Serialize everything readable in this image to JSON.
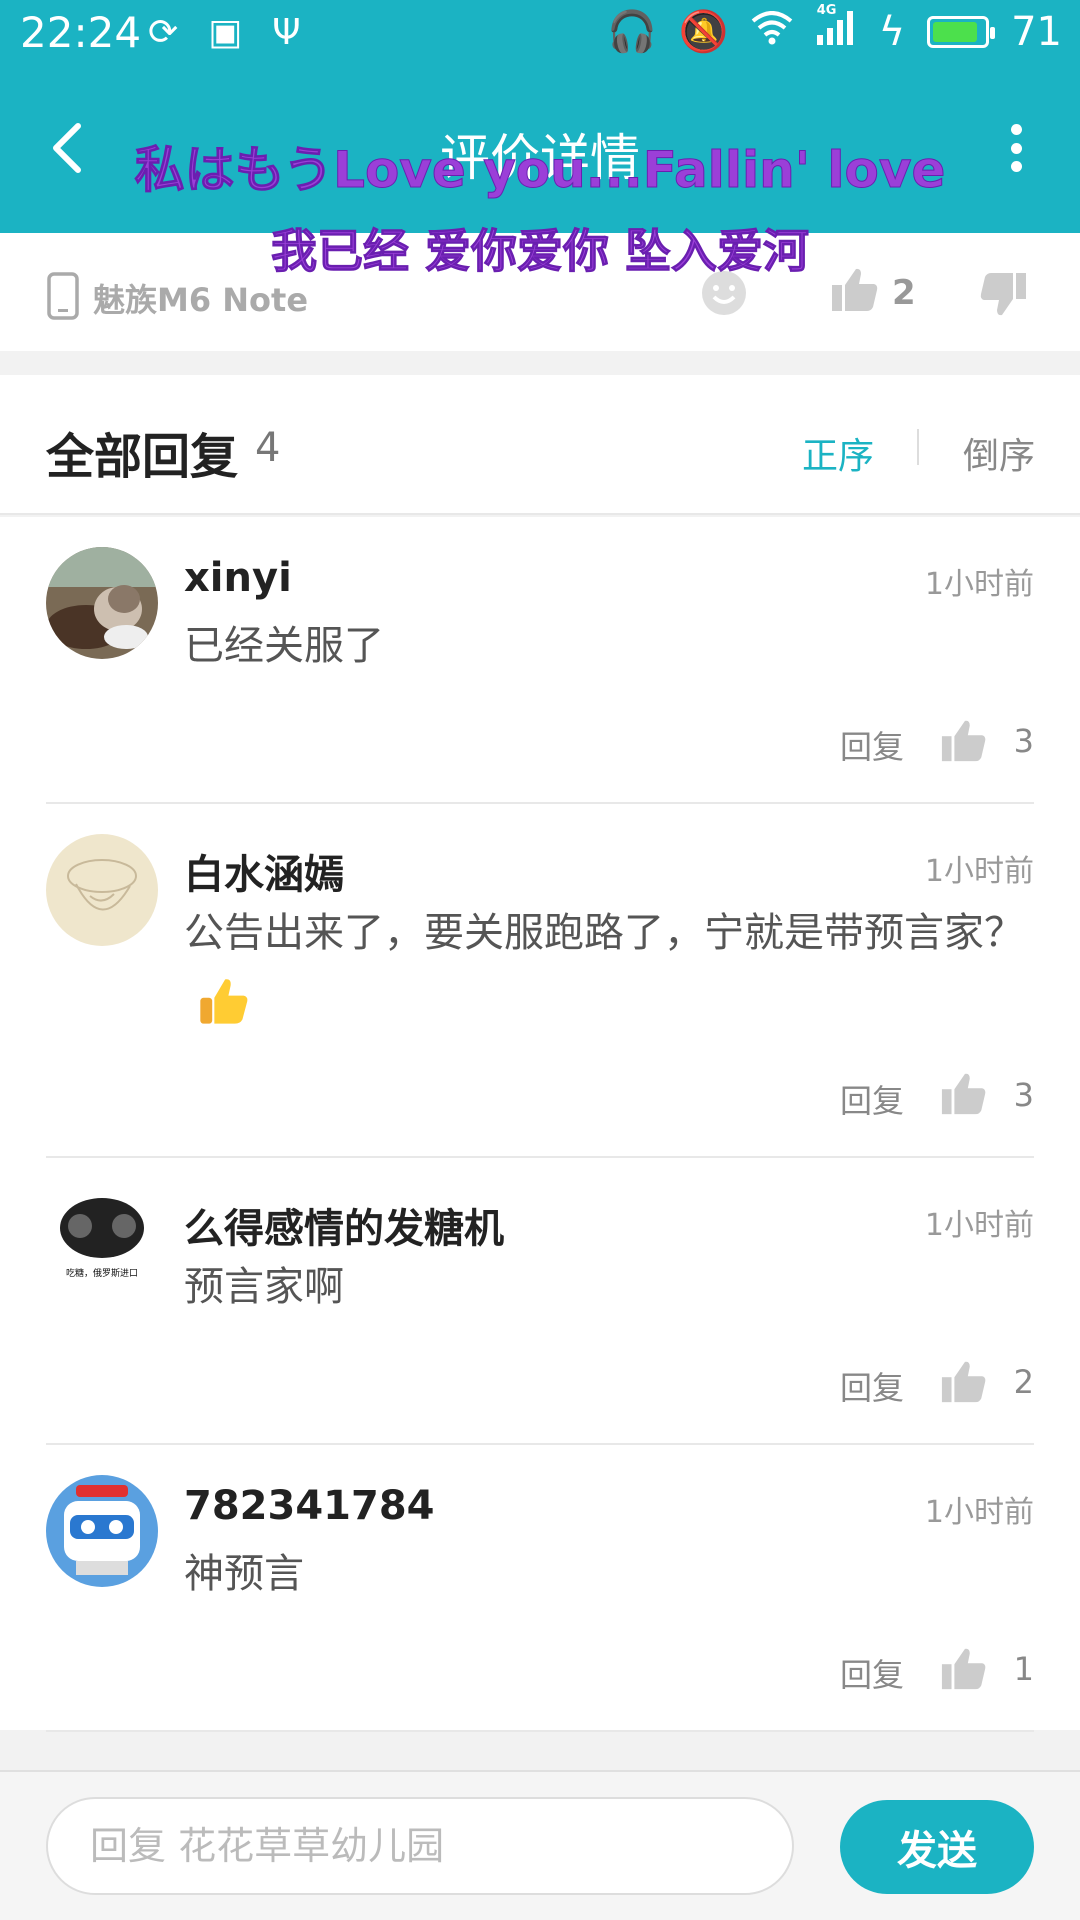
{
  "status": {
    "time": "22:24",
    "network": "4G",
    "battery": "71",
    "battery_color": "#4ce04c"
  },
  "header": {
    "title": "评价详情",
    "back_icon": "chevron-left-icon",
    "more_icon": "more-vertical-icon",
    "bg_color": "#1bb3c3"
  },
  "overlay": {
    "lyric_line1": "私はもうLove you...Fallin' love",
    "lyric_line2": "我已经 爱你爱你 坠入爱河",
    "color": "#9b3fd8"
  },
  "device_bar": {
    "device_name": "魅族M6 Note",
    "like_count": "2"
  },
  "replies": {
    "title": "全部回复",
    "count": "4",
    "sort_asc": "正序",
    "sort_desc": "倒序",
    "items": [
      {
        "user": "xinyi",
        "time": "1小时前",
        "content": "已经关服了",
        "reply_label": "回复",
        "likes": "3"
      },
      {
        "user": "白水涵嫣",
        "time": "1小时前",
        "content": "公告出来了，要关服跑路了，宁就是带预言家？",
        "reply_label": "回复",
        "likes": "3"
      },
      {
        "user": "么得感情的发糖机",
        "time": "1小时前",
        "content": "预言家啊",
        "avatar_caption": "吃糖，俄罗斯进口",
        "reply_label": "回复",
        "likes": "2"
      },
      {
        "user": "782341784",
        "time": "1小时前",
        "content": "神预言",
        "reply_label": "回复",
        "likes": "1"
      }
    ]
  },
  "composer": {
    "placeholder": "回复 花花草草幼儿园",
    "value": "",
    "send_label": "发送"
  }
}
